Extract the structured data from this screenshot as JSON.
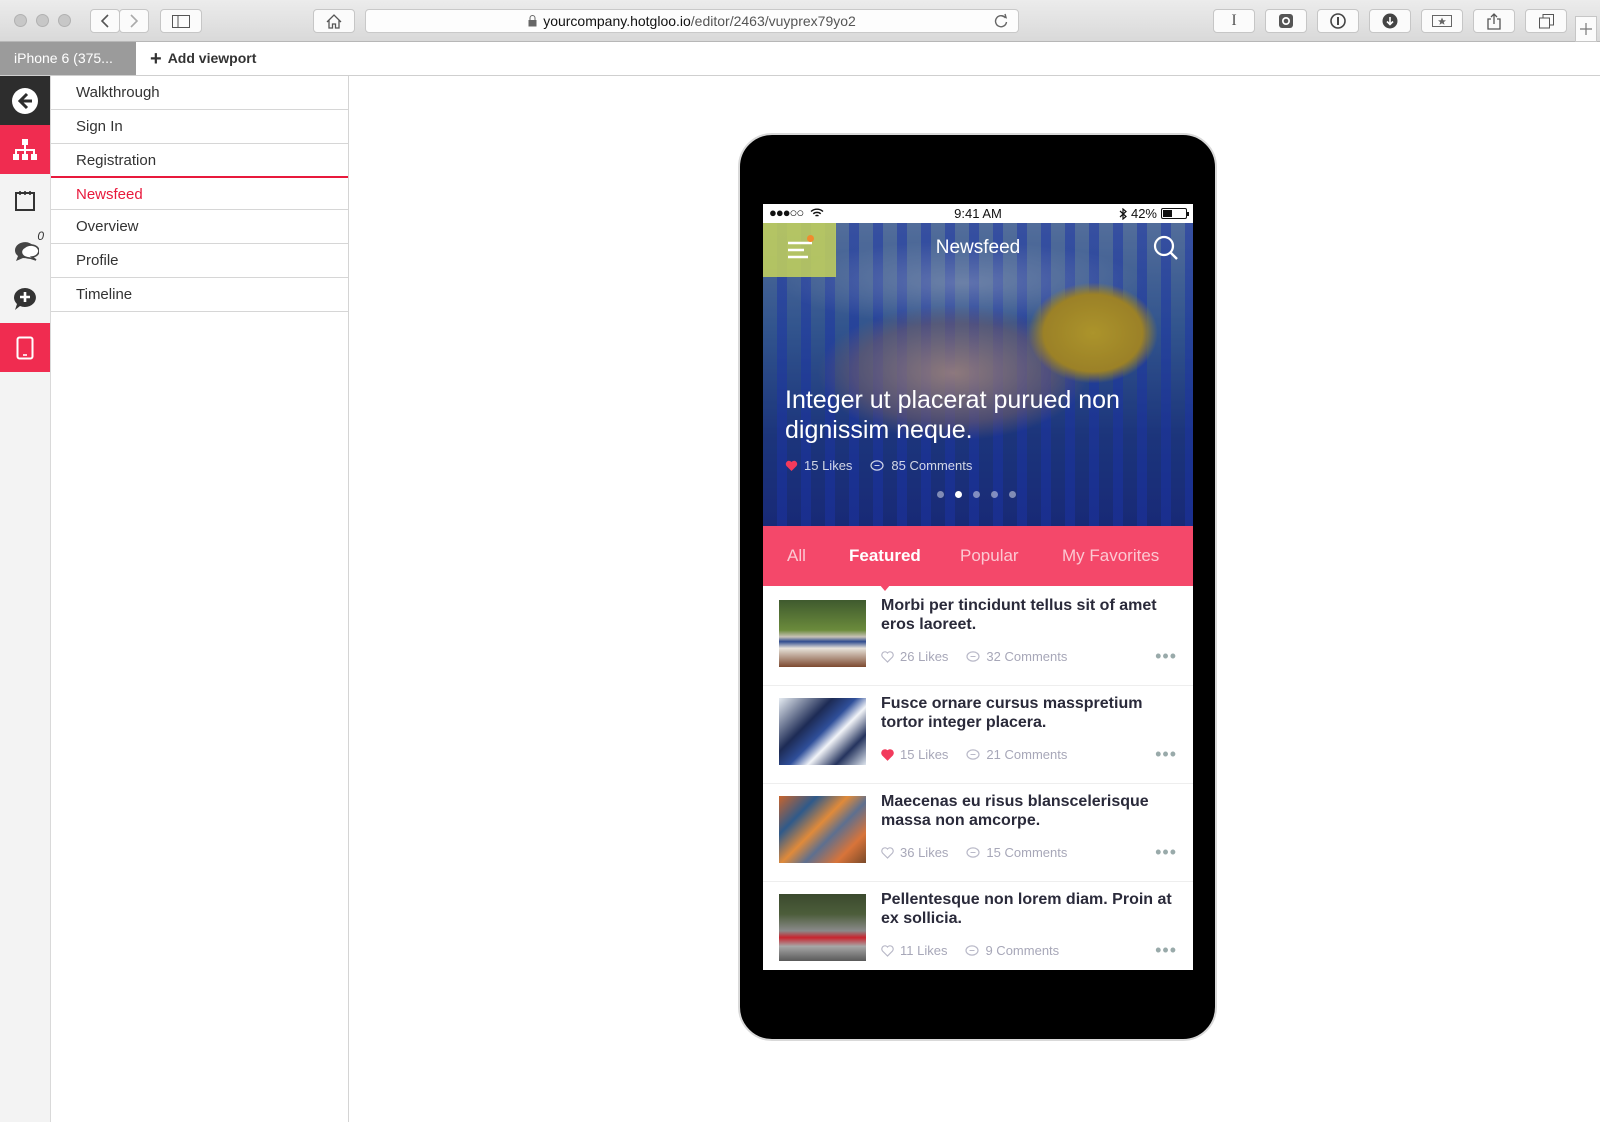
{
  "browser": {
    "url_domain": "yourcompany.hotgloo.io",
    "url_path": "/editor/2463/vuyprex79yo2"
  },
  "viewport_bar": {
    "tab_label": "iPhone 6 (375...",
    "add_label": "Add viewport"
  },
  "rail": {
    "comments_badge": "0"
  },
  "pages": [
    {
      "label": "Walkthrough",
      "active": false
    },
    {
      "label": "Sign In",
      "active": false
    },
    {
      "label": "Registration",
      "active": false
    },
    {
      "label": "Newsfeed",
      "active": true
    },
    {
      "label": "Overview",
      "active": false
    },
    {
      "label": "Profile",
      "active": false
    },
    {
      "label": "Timeline",
      "active": false
    }
  ],
  "phone": {
    "status": {
      "signal": "●●●○○",
      "time": "9:41 AM",
      "battery": "42%",
      "battery_level": 0.42
    },
    "hero": {
      "title": "Newsfeed",
      "headline": "Integer ut placerat purued non dignissim neque.",
      "likes": "15 Likes",
      "comments": "85 Comments",
      "slide_count": 5,
      "active_slide": 2
    },
    "tabs": [
      "All",
      "Featured",
      "Popular",
      "My Favorites"
    ],
    "active_tab": "Featured",
    "posts": [
      {
        "title": "Morbi per tincidunt tellus sit of amet eros laoreet.",
        "likes": "26 Likes",
        "comments": "32 Comments",
        "liked": false
      },
      {
        "title": "Fusce ornare cursus masspretium tortor integer placera.",
        "likes": "15 Likes",
        "comments": "21 Comments",
        "liked": true
      },
      {
        "title": "Maecenas eu risus blanscelerisque massa non amcorpe.",
        "likes": "36 Likes",
        "comments": "15 Comments",
        "liked": false
      },
      {
        "title": "Pellentesque non lorem diam. Proin at ex sollicia.",
        "likes": "11 Likes",
        "comments": "9 Comments",
        "liked": false
      }
    ]
  },
  "colors": {
    "accent_red": "#f02c50",
    "tab_bar": "#f4486a",
    "active_page": "#e8193c"
  }
}
